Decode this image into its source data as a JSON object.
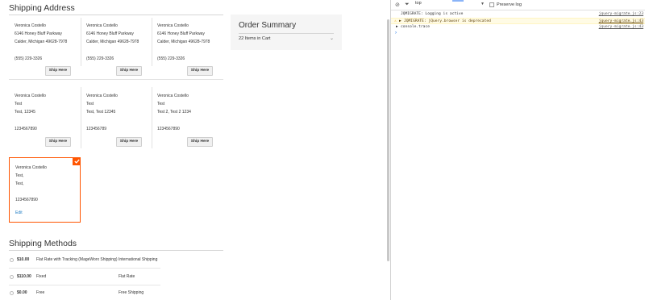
{
  "shipping": {
    "title": "Shipping Address",
    "ship_here_label": "Ship Here",
    "addresses": [
      {
        "name": "Veronica Costello",
        "street": "6146 Honey Bluff Parkway",
        "city": "Calder, Michigan 49628-7978",
        "phone": "(555) 229-3326"
      },
      {
        "name": "Veronica Costello",
        "street": "6146 Honey Bluff Parkway",
        "city": "Calder, Michigan 49628-7978",
        "phone": "(555) 229-3326"
      },
      {
        "name": "Veronica Costello",
        "street": "6146 Honey Bluff Parkway",
        "city": "Calder, Michigan 49628-7978",
        "phone": "(555) 229-3326"
      },
      {
        "name": "Veronica Costello",
        "street": "Test",
        "city": "Test, 12345",
        "phone": "1234567890"
      },
      {
        "name": "Veronica Costello",
        "street": "Test",
        "city": "Test, Test 12345",
        "phone": "123456789"
      },
      {
        "name": "Veronica Costello",
        "street": "Test",
        "city": "Test 2, Test 2 1234",
        "phone": "1234567890"
      }
    ],
    "selected": {
      "name": "Veronica Costello",
      "street": "Test,",
      "city": "Test,",
      "phone": "1234567890",
      "edit_label": "Edit"
    }
  },
  "summary": {
    "title": "Order Summary",
    "items_label": "22 Items in Cart"
  },
  "methods": {
    "title": "Shipping Methods",
    "rows": [
      {
        "price": "$10.00",
        "method": "Flat Rate with Tracking (MageWorx Shipping)",
        "carrier": "International Shipping"
      },
      {
        "price": "$110.00",
        "method": "Fixed",
        "carrier": "Flat Rate"
      },
      {
        "price": "$0.00",
        "method": "Free",
        "carrier": "Free Shipping"
      }
    ]
  },
  "console": {
    "context": "top",
    "preserve_label": "Preserve log",
    "logs": [
      {
        "level": "info",
        "message": "JQMIGRATE: Logging is active",
        "source": "jquery-migrate.js:23"
      },
      {
        "level": "warn",
        "message": "JQMIGRATE: jQuery.browser is deprecated",
        "source": "jquery-migrate.js:43"
      },
      {
        "level": "info",
        "message": "console.trace",
        "source": "jquery-migrate.js:43"
      }
    ],
    "prompt": "›"
  },
  "colors": {
    "accent": "#ff5501",
    "link": "#1979c3",
    "warn_bg": "#fffbe5"
  }
}
